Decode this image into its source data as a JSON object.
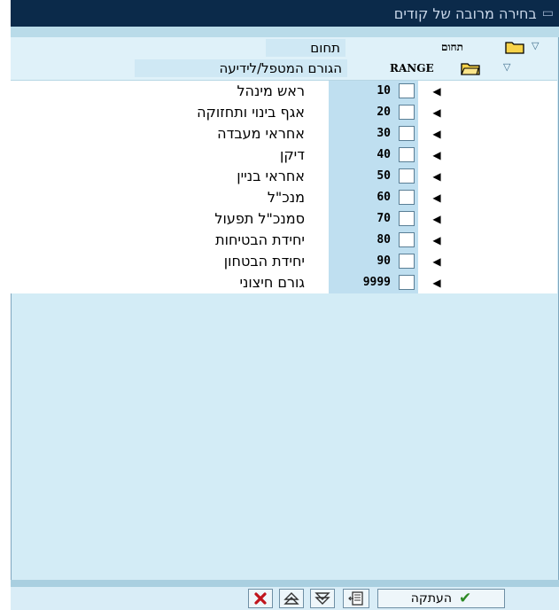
{
  "window": {
    "title": "בחירה מרובה של קודים",
    "icon": "doc-icon"
  },
  "header": {
    "level1_text": "תחום",
    "level1_code": "תחום",
    "level2_text": "הגורם המטפל/לידיעה",
    "level2_code": "RANGE"
  },
  "rows": [
    {
      "code": "10",
      "label": "ראש מינהל"
    },
    {
      "code": "20",
      "label": "אגף בינוי ותחזוקה"
    },
    {
      "code": "30",
      "label": "אחראי מעבדה"
    },
    {
      "code": "40",
      "label": "דיקן"
    },
    {
      "code": "50",
      "label": "אחראי בניין"
    },
    {
      "code": "60",
      "label": "מנכ\"ל"
    },
    {
      "code": "70",
      "label": "סמנכ\"ל תפעול"
    },
    {
      "code": "80",
      "label": "יחידת הבטיחות"
    },
    {
      "code": "90",
      "label": "יחידת הבטחון"
    },
    {
      "code": "9999",
      "label": "גורם חיצוני"
    }
  ],
  "footer": {
    "copy_label": "העתקה"
  },
  "colors": {
    "title_bar": "#0b2a4a",
    "panel": "#d3ecf6",
    "id_column": "#bfdff0",
    "check_green": "#2d8a25",
    "cancel_red": "#c0141c"
  }
}
